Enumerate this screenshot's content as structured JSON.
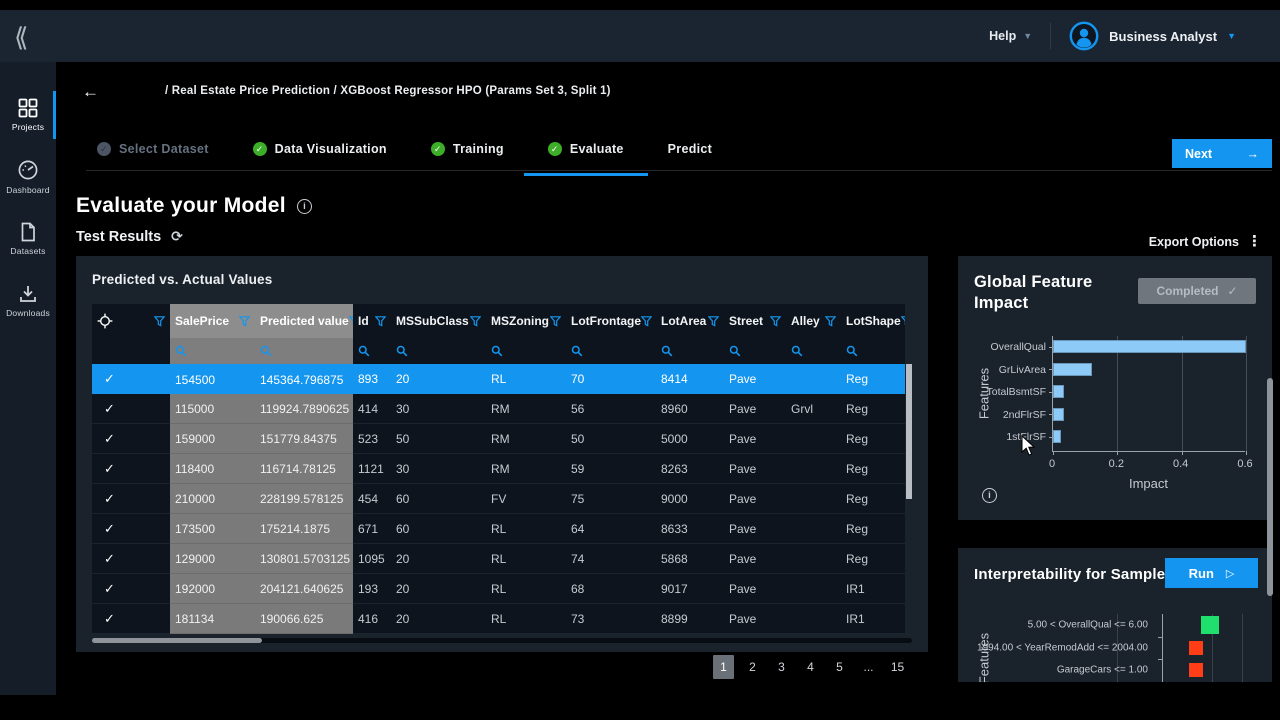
{
  "colors": {
    "accent_blue": "#1496f0",
    "selected_row_blue": "#1496f0",
    "bar_blue": "#8ecaf7",
    "positive_green": "#1fe06c",
    "negative_red": "#ff3d17",
    "check_green": "#3cae27",
    "completed_badge_bg": "#6f767e"
  },
  "topbar": {
    "help_label": "Help",
    "user_name": "Business Analyst"
  },
  "sidebar": {
    "items": [
      {
        "label": "Projects",
        "icon": "grid-icon",
        "active": true
      },
      {
        "label": "Dashboard",
        "icon": "dashboard-icon",
        "active": false
      },
      {
        "label": "Datasets",
        "icon": "datasets-icon",
        "active": false
      },
      {
        "label": "Downloads",
        "icon": "downloads-icon",
        "active": false
      }
    ]
  },
  "header": {
    "breadcrumb": "/ Real Estate Price Prediction / XGBoost Regressor HPO (Params Set 3, Split 1)",
    "next_label": "Next"
  },
  "tabs": [
    {
      "label": "Select Dataset",
      "status": "done-muted",
      "active": false
    },
    {
      "label": "Data Visualization",
      "status": "done",
      "active": false
    },
    {
      "label": "Training",
      "status": "done",
      "active": false
    },
    {
      "label": "Evaluate",
      "status": "done",
      "active": true
    },
    {
      "label": "Predict",
      "status": "none",
      "active": false
    }
  ],
  "page": {
    "title": "Evaluate your Model",
    "subtitle": "Test Results",
    "export_options_label": "Export Options"
  },
  "results_table": {
    "title": "Predicted vs. Actual Values",
    "columns": [
      "SalePrice",
      "Predicted value",
      "Id",
      "MSSubClass",
      "MSZoning",
      "LotFrontage",
      "LotArea",
      "Street",
      "Alley",
      "LotShape"
    ],
    "highlighted_columns": [
      "SalePrice",
      "Predicted value"
    ],
    "rows": [
      [
        "154500",
        "145364.796875",
        "893",
        "20",
        "RL",
        "70",
        "8414",
        "Pave",
        "",
        "Reg"
      ],
      [
        "115000",
        "119924.7890625",
        "414",
        "30",
        "RM",
        "56",
        "8960",
        "Pave",
        "Grvl",
        "Reg"
      ],
      [
        "159000",
        "151779.84375",
        "523",
        "50",
        "RM",
        "50",
        "5000",
        "Pave",
        "",
        "Reg"
      ],
      [
        "118400",
        "116714.78125",
        "1121",
        "30",
        "RM",
        "59",
        "8263",
        "Pave",
        "",
        "Reg"
      ],
      [
        "210000",
        "228199.578125",
        "454",
        "60",
        "FV",
        "75",
        "9000",
        "Pave",
        "",
        "Reg"
      ],
      [
        "173500",
        "175214.1875",
        "671",
        "60",
        "RL",
        "64",
        "8633",
        "Pave",
        "",
        "Reg"
      ],
      [
        "129000",
        "130801.5703125",
        "1095",
        "20",
        "RL",
        "74",
        "5868",
        "Pave",
        "",
        "Reg"
      ],
      [
        "192000",
        "204121.640625",
        "193",
        "20",
        "RL",
        "68",
        "9017",
        "Pave",
        "",
        "IR1"
      ],
      [
        "181134",
        "190066.625",
        "416",
        "20",
        "RL",
        "73",
        "8899",
        "Pave",
        "",
        "IR1"
      ]
    ],
    "selected_row_index": 0,
    "pagination": [
      "1",
      "2",
      "3",
      "4",
      "5",
      "...",
      "15"
    ],
    "active_page": "1"
  },
  "feature_impact": {
    "title": "Global Feature Impact",
    "status_label": "Completed"
  },
  "interpretability": {
    "title": "Interpretability for Sample",
    "run_label": "Run"
  },
  "chart_data": [
    {
      "type": "bar",
      "orientation": "horizontal",
      "title": "Global Feature Impact",
      "categories": [
        "OverallQual",
        "GrLivArea",
        "TotalBsmtSF",
        "2ndFlrSF",
        "1stFlrSF"
      ],
      "values": [
        0.6,
        0.12,
        0.035,
        0.035,
        0.025
      ],
      "xlabel": "Impact",
      "ylabel": "Features",
      "xlim": [
        0,
        0.6
      ],
      "xticks": [
        "0",
        "0.2",
        "0.4",
        "0.6"
      ],
      "grid": true,
      "bar_color": "#8ecaf7"
    },
    {
      "type": "scatter",
      "title": "Interpretability for Sample",
      "ylabel": "Features",
      "categories": [
        "5.00 < OverallQual <= 6.00",
        "1994.00 < YearRemodAdd <= 2004.00",
        "GarageCars <= 1.00"
      ],
      "values_estimated": [
        0.9,
        0.6,
        0.6
      ],
      "point_colors": [
        "#1fe06c",
        "#ff3d17",
        "#ff3d17"
      ],
      "grid": true,
      "xaxis_labels_visible": false
    }
  ]
}
